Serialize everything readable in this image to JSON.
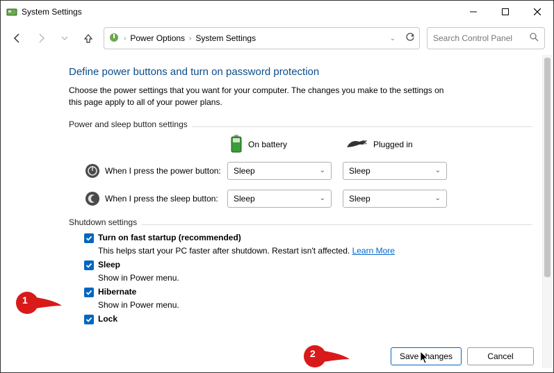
{
  "titlebar": {
    "title": "System Settings"
  },
  "breadcrumb": {
    "item1": "Power Options",
    "item2": "System Settings"
  },
  "search": {
    "placeholder": "Search Control Panel"
  },
  "page": {
    "heading": "Define power buttons and turn on password protection",
    "description": "Choose the power settings that you want for your computer. The changes you make to the settings on this page apply to all of your power plans."
  },
  "group1": {
    "legend": "Power and sleep button settings",
    "col_battery": "On battery",
    "col_plugged": "Plugged in",
    "row_power_label": "When I press the power button:",
    "row_power_battery": "Sleep",
    "row_power_plugged": "Sleep",
    "row_sleep_label": "When I press the sleep button:",
    "row_sleep_battery": "Sleep",
    "row_sleep_plugged": "Sleep"
  },
  "group2": {
    "legend": "Shutdown settings",
    "fast_label": "Turn on fast startup (recommended)",
    "fast_sub": "This helps start your PC faster after shutdown. Restart isn't affected. ",
    "fast_link": "Learn More",
    "sleep_label": "Sleep",
    "sleep_sub": "Show in Power menu.",
    "hibernate_label": "Hibernate",
    "hibernate_sub": "Show in Power menu.",
    "lock_label": "Lock"
  },
  "footer": {
    "save": "Save changes",
    "cancel": "Cancel"
  },
  "callouts": {
    "one": "1",
    "two": "2"
  }
}
